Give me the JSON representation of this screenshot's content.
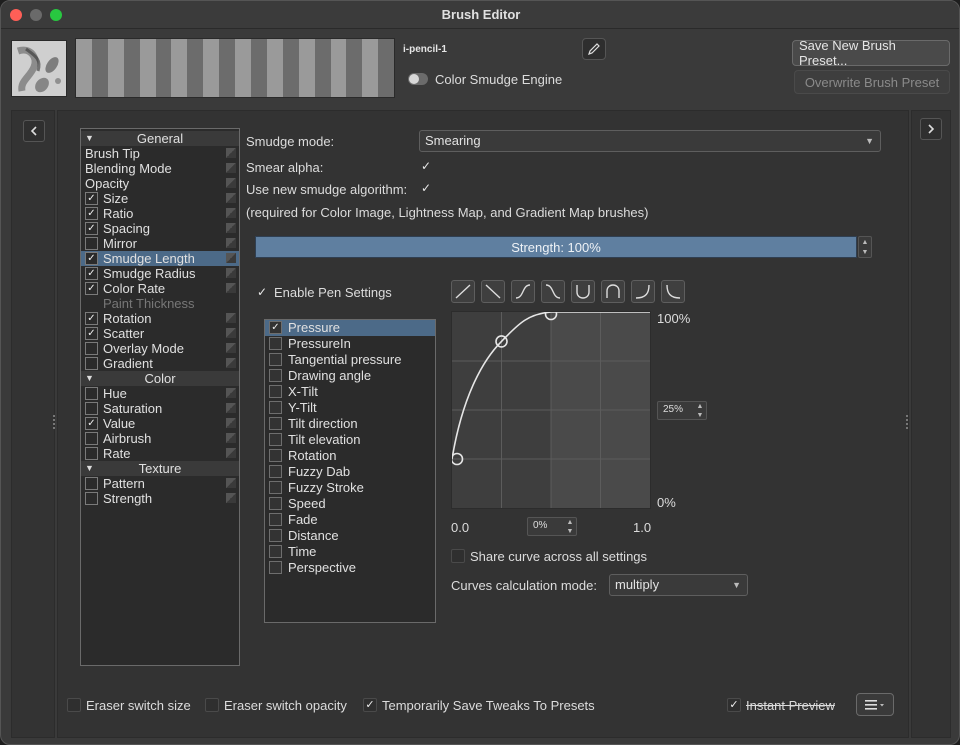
{
  "window": {
    "title": "Brush Editor"
  },
  "header": {
    "preset_name": "i-pencil-1",
    "engine_label": "Color Smudge Engine",
    "save_new_label": "Save New Brush Preset...",
    "overwrite_label": "Overwrite Brush Preset"
  },
  "options_tree": [
    {
      "type": "header",
      "label": "General"
    },
    {
      "type": "plain",
      "label": "Brush Tip"
    },
    {
      "type": "plain",
      "label": "Blending Mode"
    },
    {
      "type": "plain",
      "label": "Opacity"
    },
    {
      "type": "item",
      "label": "Size",
      "checked": true
    },
    {
      "type": "item",
      "label": "Ratio",
      "checked": true
    },
    {
      "type": "item",
      "label": "Spacing",
      "checked": true
    },
    {
      "type": "item",
      "label": "Mirror",
      "checked": false
    },
    {
      "type": "item",
      "label": "Smudge Length",
      "checked": true,
      "selected": true
    },
    {
      "type": "item",
      "label": "Smudge Radius",
      "checked": true
    },
    {
      "type": "item",
      "label": "Color Rate",
      "checked": true
    },
    {
      "type": "item",
      "label": "Paint Thickness",
      "checked": false,
      "disabled": true
    },
    {
      "type": "item",
      "label": "Rotation",
      "checked": true
    },
    {
      "type": "item",
      "label": "Scatter",
      "checked": true
    },
    {
      "type": "item",
      "label": "Overlay Mode",
      "checked": false
    },
    {
      "type": "item",
      "label": "Gradient",
      "checked": false
    },
    {
      "type": "header",
      "label": "Color"
    },
    {
      "type": "item",
      "label": "Hue",
      "checked": false
    },
    {
      "type": "item",
      "label": "Saturation",
      "checked": false
    },
    {
      "type": "item",
      "label": "Value",
      "checked": true
    },
    {
      "type": "item",
      "label": "Airbrush",
      "checked": false
    },
    {
      "type": "item",
      "label": "Rate",
      "checked": false
    },
    {
      "type": "header",
      "label": "Texture"
    },
    {
      "type": "item",
      "label": "Pattern",
      "checked": false
    },
    {
      "type": "item",
      "label": "Strength",
      "checked": false
    }
  ],
  "smudge": {
    "mode_label": "Smudge mode:",
    "mode_value": "Smearing",
    "smear_alpha_label": "Smear alpha:",
    "smear_alpha_checked": true,
    "new_algo_label": "Use new smudge algorithm:",
    "new_algo_checked": true,
    "note": "(required for Color Image, Lightness Map, and Gradient Map brushes)",
    "strength_label": "Strength: 100%",
    "strength_value": 100
  },
  "pen": {
    "enable_label": "Enable Pen Settings",
    "enable_checked": true,
    "sensors": [
      {
        "label": "Pressure",
        "checked": true,
        "selected": true
      },
      {
        "label": "PressureIn",
        "checked": false
      },
      {
        "label": "Tangential pressure",
        "checked": false
      },
      {
        "label": "Drawing angle",
        "checked": false
      },
      {
        "label": "X-Tilt",
        "checked": false
      },
      {
        "label": "Y-Tilt",
        "checked": false
      },
      {
        "label": "Tilt direction",
        "checked": false
      },
      {
        "label": "Tilt elevation",
        "checked": false
      },
      {
        "label": "Rotation",
        "checked": false
      },
      {
        "label": "Fuzzy Dab",
        "checked": false
      },
      {
        "label": "Fuzzy Stroke",
        "checked": false
      },
      {
        "label": "Speed",
        "checked": false
      },
      {
        "label": "Fade",
        "checked": false
      },
      {
        "label": "Distance",
        "checked": false
      },
      {
        "label": "Time",
        "checked": false
      },
      {
        "label": "Perspective",
        "checked": false
      }
    ]
  },
  "curve": {
    "y_max_label": "100%",
    "y_min_label": "0%",
    "x_min_label": "0.0",
    "x_max_label": "1.0",
    "y_spin_value": "25%",
    "x_spin_value": "0%",
    "share_label": "Share curve across all settings",
    "share_checked": false,
    "calc_label": "Curves calculation mode:",
    "calc_value": "multiply",
    "points": [
      [
        0.0,
        0.25
      ],
      [
        0.25,
        0.85
      ],
      [
        0.5,
        1.0
      ]
    ]
  },
  "footer": {
    "eraser_size_label": "Eraser switch size",
    "eraser_size_checked": false,
    "eraser_opacity_label": "Eraser switch opacity",
    "eraser_opacity_checked": false,
    "save_tweaks_label": "Temporarily Save Tweaks To Presets",
    "save_tweaks_checked": true,
    "instant_preview_label": "Instant Preview",
    "instant_preview_checked": true
  }
}
